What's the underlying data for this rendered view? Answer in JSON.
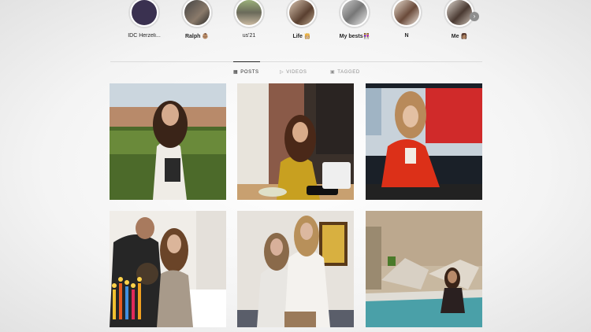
{
  "stories": [
    {
      "label": "IDC Herzeli..."
    },
    {
      "label": "Ralph 👶🏽"
    },
    {
      "label": "us'21"
    },
    {
      "label": "Life 👸🏼"
    },
    {
      "label": "My bests👭"
    },
    {
      "label": "N"
    },
    {
      "label": "Me 👩🏽"
    }
  ],
  "tabs": [
    {
      "label": "POSTS",
      "icon": "grid-icon",
      "active": true
    },
    {
      "label": "VIDEOS",
      "icon": "video-icon",
      "active": false
    },
    {
      "label": "TAGGED",
      "icon": "tag-icon",
      "active": false
    }
  ],
  "next_icon": "chevron-right-icon",
  "posts": [
    {
      "icon": "photo"
    },
    {
      "icon": "photo"
    },
    {
      "icon": "photo"
    },
    {
      "icon": "photo"
    },
    {
      "icon": "photo"
    },
    {
      "icon": "photo"
    }
  ]
}
